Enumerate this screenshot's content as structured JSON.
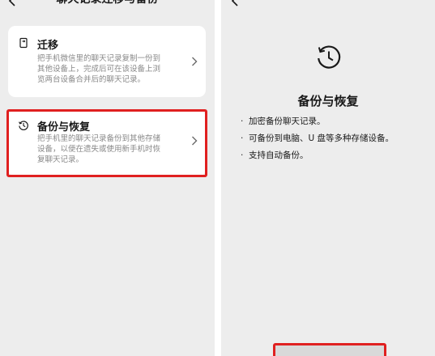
{
  "left": {
    "nav_title": "聊天记录迁移与备份",
    "cards": [
      {
        "title": "迁移",
        "icon": "phone-transfer-icon",
        "desc_lines": [
          "把手机微信里的聊天记录复制一份到",
          "其他设备上，完成后可在该设备上浏",
          "览两台设备合并后的聊天记录。"
        ]
      },
      {
        "title": "备份与恢复",
        "icon": "history-clock-icon",
        "desc_lines": [
          "把手机里的聊天记录备份到其他存储",
          "设备，以便在遗失或使用新手机时恢",
          "复聊天记录。"
        ]
      }
    ]
  },
  "right": {
    "title": "备份与恢复",
    "icon": "history-clock-icon",
    "features": [
      "加密备份聊天记录。",
      "可备份到电脑、U 盘等多种存储设备。",
      "支持自动备份。"
    ]
  },
  "colors": {
    "background": "#ededed",
    "card": "#ffffff",
    "highlight": "#e02020",
    "muted_text": "#888888"
  }
}
